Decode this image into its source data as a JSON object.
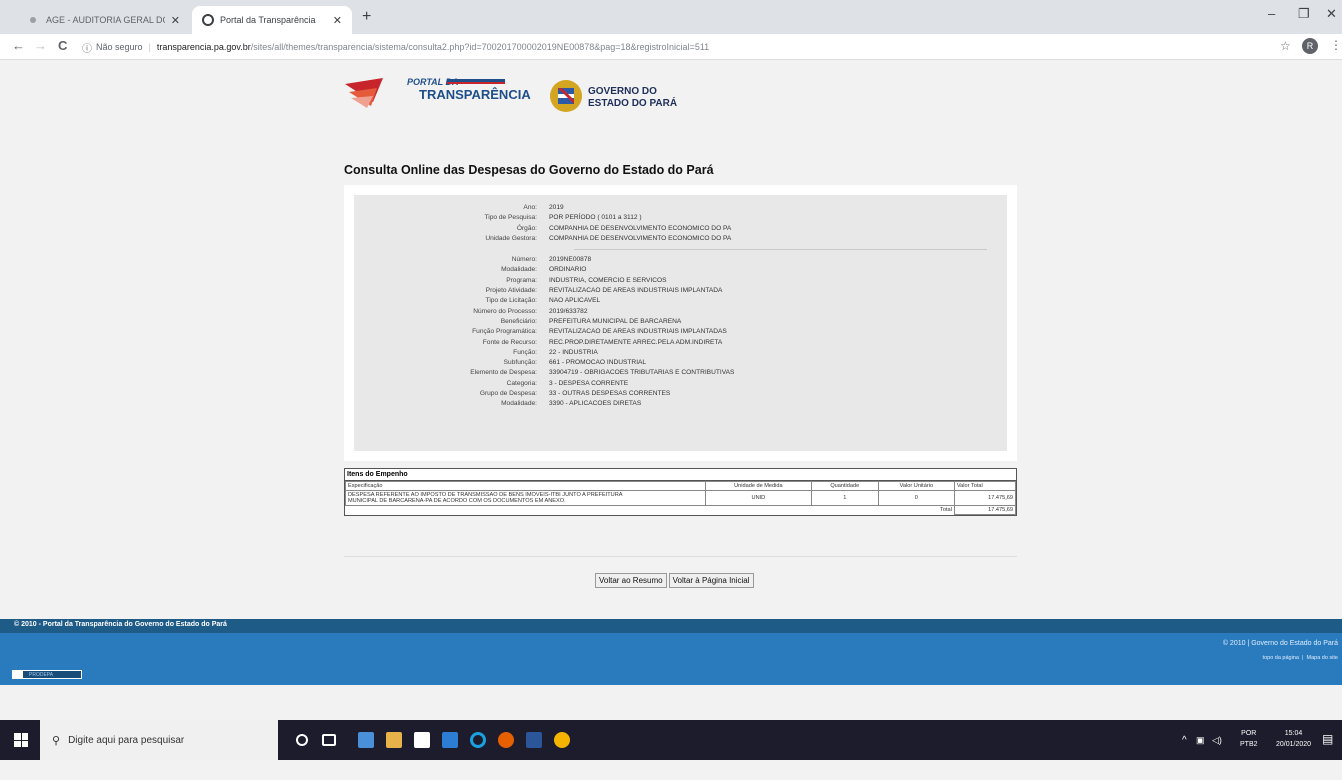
{
  "browser": {
    "tabs": [
      {
        "title": "AGE - AUDITORIA GERAL DO ES",
        "active": false
      },
      {
        "title": "Portal da Transparência",
        "active": true
      }
    ],
    "new_tab": "+",
    "window_controls": {
      "minimize": "–",
      "maximize": "❐",
      "close": "✕"
    },
    "nav": {
      "back": "←",
      "forward": "→",
      "reload": "C"
    },
    "security_label": "Não seguro",
    "url_host": "transparencia.pa.gov.br",
    "url_path": "/sites/all/themes/transparencia/sistema/consulta2.php?id=700201700002019NE00878&pag=18&registroInicial=511",
    "profile_initial": "R"
  },
  "header": {
    "portal_logo_line1": "PORTAL DA",
    "portal_logo_line2": "TRANSPARÊNCIA",
    "gov_logo_line1": "GOVERNO DO",
    "gov_logo_line2": "ESTADO DO PARÁ"
  },
  "page_title": "Consulta Online das Despesas do Governo do Estado do Pará",
  "details_top": [
    {
      "label": "Ano:",
      "value": "2019"
    },
    {
      "label": "Tipo de Pesquisa:",
      "value": "POR PERÍODO ( 0101 a 3112 )"
    },
    {
      "label": "Órgão:",
      "value": "COMPANHIA DE DESENVOLVIMENTO ECONOMICO DO PA"
    },
    {
      "label": "Unidade Gestora:",
      "value": "COMPANHIA DE DESENVOLVIMENTO ECONOMICO DO PA"
    }
  ],
  "details_bottom": [
    {
      "label": "Número:",
      "value": "2019NE00878"
    },
    {
      "label": "Modalidade:",
      "value": "ORDINARIO"
    },
    {
      "label": "Programa:",
      "value": "INDUSTRIA, COMERCIO E SERVICOS"
    },
    {
      "label": "Projeto Atividade:",
      "value": "REVITALIZACAO DE AREAS INDUSTRIAIS IMPLANTADA"
    },
    {
      "label": "Tipo de Licitação:",
      "value": "NAO APLICAVEL"
    },
    {
      "label": "Número do Processo:",
      "value": "2019/633782"
    },
    {
      "label": "Beneficiário:",
      "value": "PREFEITURA MUNICIPAL DE BARCARENA"
    },
    {
      "label": "Função Programática:",
      "value": "REVITALIZACAO DE AREAS INDUSTRIAIS IMPLANTADAS"
    },
    {
      "label": "Fonte de Recurso:",
      "value": "REC.PROP.DIRETAMENTE ARREC.PELA ADM.INDIRETA"
    },
    {
      "label": "Função:",
      "value": "22 - INDUSTRIA"
    },
    {
      "label": "Subfunção:",
      "value": "661 - PROMOCAO INDUSTRIAL"
    },
    {
      "label": "Elemento de Despesa:",
      "value": "33904719 - OBRIGACOES TRIBUTARIAS E CONTRIBUTIVAS"
    },
    {
      "label": "Categoria:",
      "value": "3 - DESPESA CORRENTE"
    },
    {
      "label": "Grupo de Despesa:",
      "value": "33 - OUTRAS DESPESAS CORRENTES"
    },
    {
      "label": "Modalidade:",
      "value": "3390 - APLICACOES DIRETAS"
    }
  ],
  "items": {
    "title": "Itens do Empenho",
    "headers": [
      "Especificação",
      "Unidade de Medida",
      "Quantidade",
      "Valor Unitário",
      "Valor Total"
    ],
    "rows": [
      {
        "spec_line1": "DESPESA REFERENTE AO IMPOSTO DE TRANSMISSAO DE BENS IMOVEIS-ITBI JUNTO A PREFEITURA",
        "spec_line2": "MUNICIPAL DE BARCARENA-PA DE ACORDO COM OS DOCUMENTOS EM ANEXO.",
        "unit": "UNID",
        "qty": "1",
        "unit_value": "0",
        "total": "17.475,69"
      }
    ],
    "total_label": "Total",
    "total_value": "17.475,69"
  },
  "buttons": {
    "back_summary": "Voltar ao Resumo",
    "home": "Voltar à Página Inicial"
  },
  "footer": {
    "left": "© 2010 - Portal da Transparência do Governo do Estado do Pará",
    "right": "© 2010 | Governo do Estado do Pará",
    "link_top": "topo da página",
    "link_sitemap": "Mapa do site",
    "prodepa": "PRODEPA"
  },
  "taskbar": {
    "search_placeholder": "Digite aqui para pesquisar",
    "lang": "POR",
    "lang_sub": "PTB2",
    "time": "15:04",
    "date": "20/01/2020"
  }
}
